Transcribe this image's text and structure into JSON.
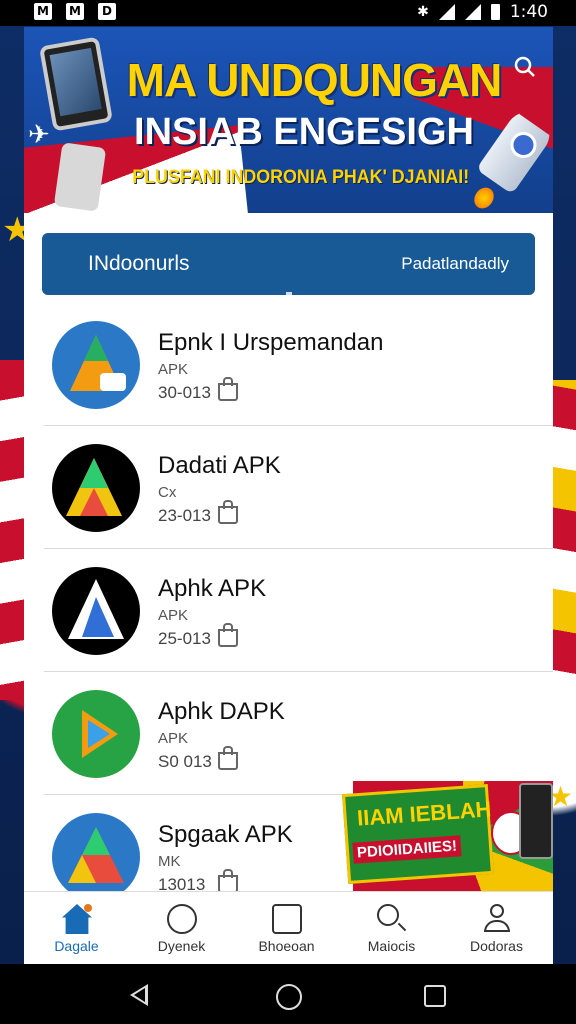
{
  "status_bar": {
    "notif_icons": [
      "M",
      "M",
      "D"
    ],
    "time": "1:40"
  },
  "banner": {
    "title_line1": "MA UNDQUNGAN",
    "title_line2": "INSIAB ENGESIGH",
    "subtitle": "PLUSFANI INDORONIA PHAK' DJANIAI!",
    "search_icon": "search-icon"
  },
  "tabs": [
    {
      "label": "INdoonurls"
    },
    {
      "label": "Padatlandadly"
    }
  ],
  "apps": [
    {
      "name": "Epnk I Urspemandan",
      "sub": "APK",
      "size": "30-013"
    },
    {
      "name": "Dadati APK",
      "sub": "Cx",
      "size": "23-013"
    },
    {
      "name": "Aphk APK",
      "sub": "APK",
      "size": "25-013"
    },
    {
      "name": "Aphk DAPK",
      "sub": "APK",
      "size": "S0 013"
    },
    {
      "name": "Spgaak APK",
      "sub": "MK",
      "size": "13013"
    }
  ],
  "promo": {
    "line1": "IIAM IEBLAH",
    "line2": "PDIOIIDAIIES!"
  },
  "bottom_nav": [
    {
      "label": "Dagale",
      "icon": "home-icon",
      "active": true
    },
    {
      "label": "Dyenek",
      "icon": "categories-icon",
      "active": false
    },
    {
      "label": "Bhoeoan",
      "icon": "trending-icon",
      "active": false
    },
    {
      "label": "Maiocis",
      "icon": "search-icon",
      "active": false
    },
    {
      "label": "Dodoras",
      "icon": "profile-icon",
      "active": false
    }
  ],
  "colors": {
    "tab_bar": "#175a95",
    "accent": "#1a6bb5",
    "banner_title": "#ffd200"
  }
}
